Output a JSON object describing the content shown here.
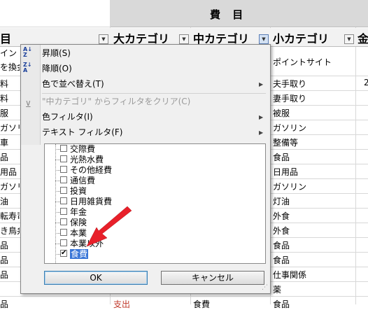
{
  "sheet": {
    "title_band": "費 目",
    "headers": {
      "col_a": "目",
      "large_cat": "大カテゴリ",
      "mid_cat": "中カテゴリ",
      "small_cat": "小カテゴリ",
      "amount": "金"
    },
    "col_a": [
      "イント",
      "を換金",
      "料",
      "料",
      "服",
      "ガソリ",
      "車",
      "品",
      "用品",
      "ガソリ",
      "油",
      "転寿司",
      "き鳥弁",
      "品",
      "品",
      "品",
      "",
      "品"
    ],
    "col_small": [
      "ポイントサイト",
      "夫手取り",
      "妻手取り",
      "被服",
      "ガソリン",
      "整備等",
      "食品",
      "日用品",
      "ガソリン",
      "灯油",
      "外食",
      "外食",
      "食品",
      "食品",
      "仕事関係",
      "薬",
      "食品"
    ],
    "col_e_peek": "2",
    "bottom_large": "支出",
    "bottom_mid": "食費"
  },
  "menu": {
    "sort_asc": "昇順(S)",
    "sort_desc": "降順(O)",
    "sort_by_color": "色で並べ替え(T)",
    "clear_filter": "\"中カテゴリ\" からフィルタをクリア(C)",
    "color_filter": "色フィルタ(I)",
    "text_filter": "テキスト フィルタ(F)"
  },
  "list": {
    "items": [
      {
        "label": "交際費",
        "checked": false
      },
      {
        "label": "光熱水費",
        "checked": false
      },
      {
        "label": "その他経費",
        "checked": false
      },
      {
        "label": "通信費",
        "checked": false
      },
      {
        "label": "投資",
        "checked": false
      },
      {
        "label": "日用雑貨費",
        "checked": false
      },
      {
        "label": "年金",
        "checked": false
      },
      {
        "label": "保険",
        "checked": false
      },
      {
        "label": "本業",
        "checked": false
      },
      {
        "label": "本業以外",
        "checked": false
      },
      {
        "label": "食費",
        "checked": true
      }
    ]
  },
  "buttons": {
    "ok": "OK",
    "cancel": "キャンセル"
  },
  "colors": {
    "annotation_arrow": "#e8202a",
    "selection": "#3875d7",
    "bottom_large_text": "#c0392b"
  }
}
